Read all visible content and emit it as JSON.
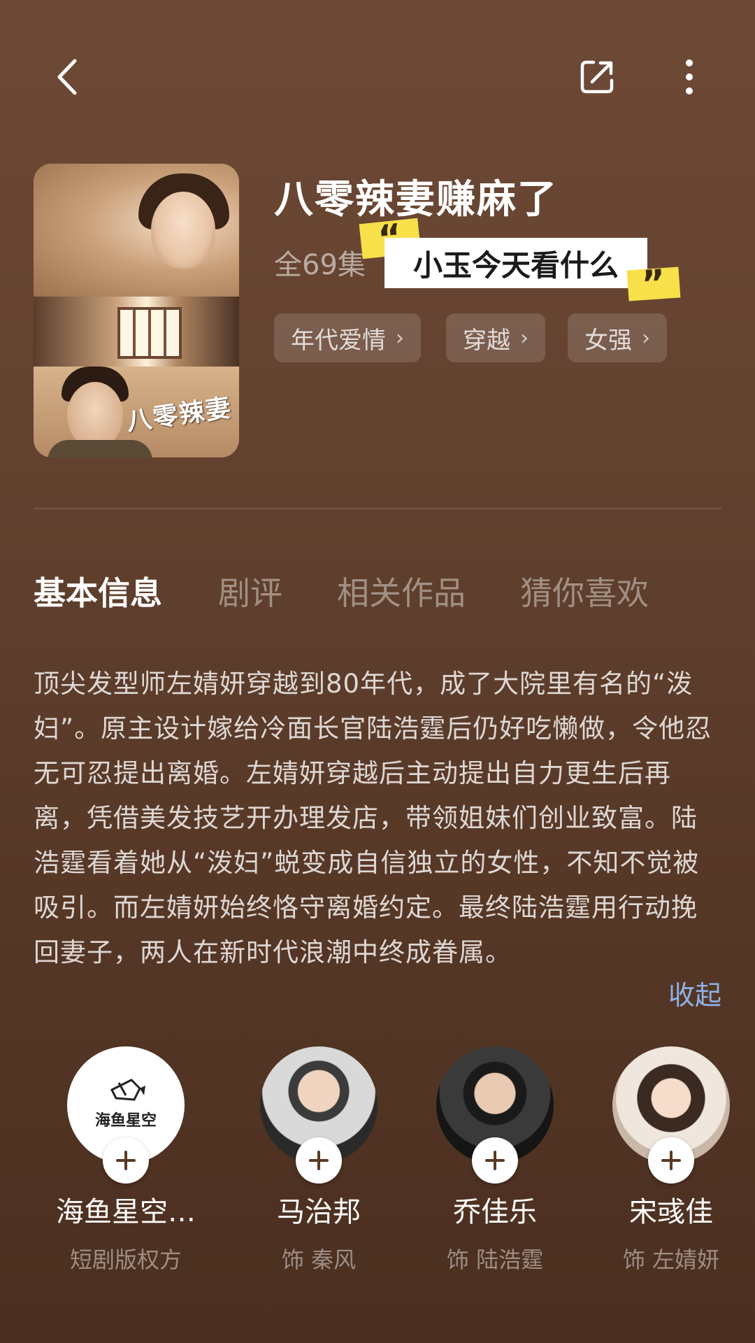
{
  "header": {
    "back_icon": "chevron-left-icon",
    "share_icon": "share-icon",
    "more_icon": "more-vertical-icon"
  },
  "drama": {
    "poster_title": "八零辣妻",
    "title": "八零辣妻赚麻了",
    "episodes": "全69集",
    "tags": [
      {
        "label": "年代爱情"
      },
      {
        "label": "穿越"
      },
      {
        "label": "女强"
      }
    ]
  },
  "watermark": {
    "text": "小玉今天看什么",
    "open_quote": "“",
    "close_quote": "”",
    "accent_color": "#f7e04a"
  },
  "tabs": [
    {
      "label": "基本信息",
      "active": true
    },
    {
      "label": "剧评",
      "active": false
    },
    {
      "label": "相关作品",
      "active": false
    },
    {
      "label": "猜你喜欢",
      "active": false
    }
  ],
  "synopsis": {
    "text": "顶尖发型师左婧妍穿越到80年代，成了大院里有名的“泼妇”。原主设计嫁给冷面长官陆浩霆后仍好吃懒做，令他忍无可忍提出离婚。左婧妍穿越后主动提出自力更生后再离，凭借美发技艺开办理发店，带领姐妹们创业致富。陆浩霆看着她从“泼妇”蜕变成自信独立的女性，不知不觉被吸引。而左婧妍始终恪守离婚约定。最终陆浩霆用行动挽回妻子，两人在新时代浪潮中终成眷属。",
    "collapse_label": "收起"
  },
  "cast": [
    {
      "name": "海鱼星空…",
      "role": "短剧版权方",
      "logo_text": "海鱼星空"
    },
    {
      "name": "马治邦",
      "role": "饰 秦风"
    },
    {
      "name": "乔佳乐",
      "role": "饰 陆浩霆"
    },
    {
      "name": "宋彧佳",
      "role": "饰 左婧妍"
    }
  ],
  "colors": {
    "link": "#8fb2e8"
  }
}
